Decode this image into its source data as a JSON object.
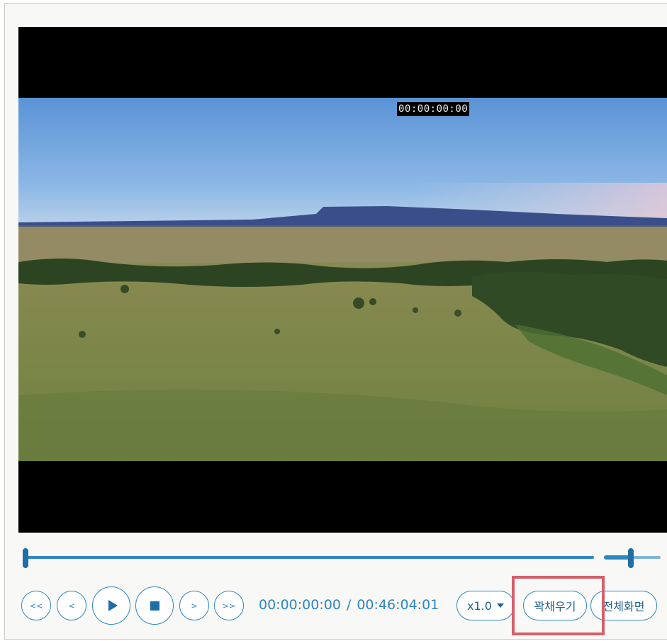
{
  "video": {
    "timecode_overlay": "00:00:00:00"
  },
  "controls": {
    "rewind_fast_label": "<<",
    "step_back_label": "<",
    "play_icon": "play-icon",
    "stop_icon": "stop-icon",
    "step_forward_label": ">",
    "forward_fast_label": ">>",
    "current_time": "00:00:00:00",
    "separator": "/",
    "total_time": "00:46:04:01",
    "speed_label": "x1.0",
    "fill_label": "꽉채우기",
    "fullscreen_label": "전체화면"
  },
  "seek": {
    "position_fraction": 0.0
  },
  "volume": {
    "level_fraction": 0.47
  },
  "colors": {
    "accent": "#2e86c1",
    "accent_dark": "#1f6fa6",
    "highlight": "#d4606a"
  }
}
